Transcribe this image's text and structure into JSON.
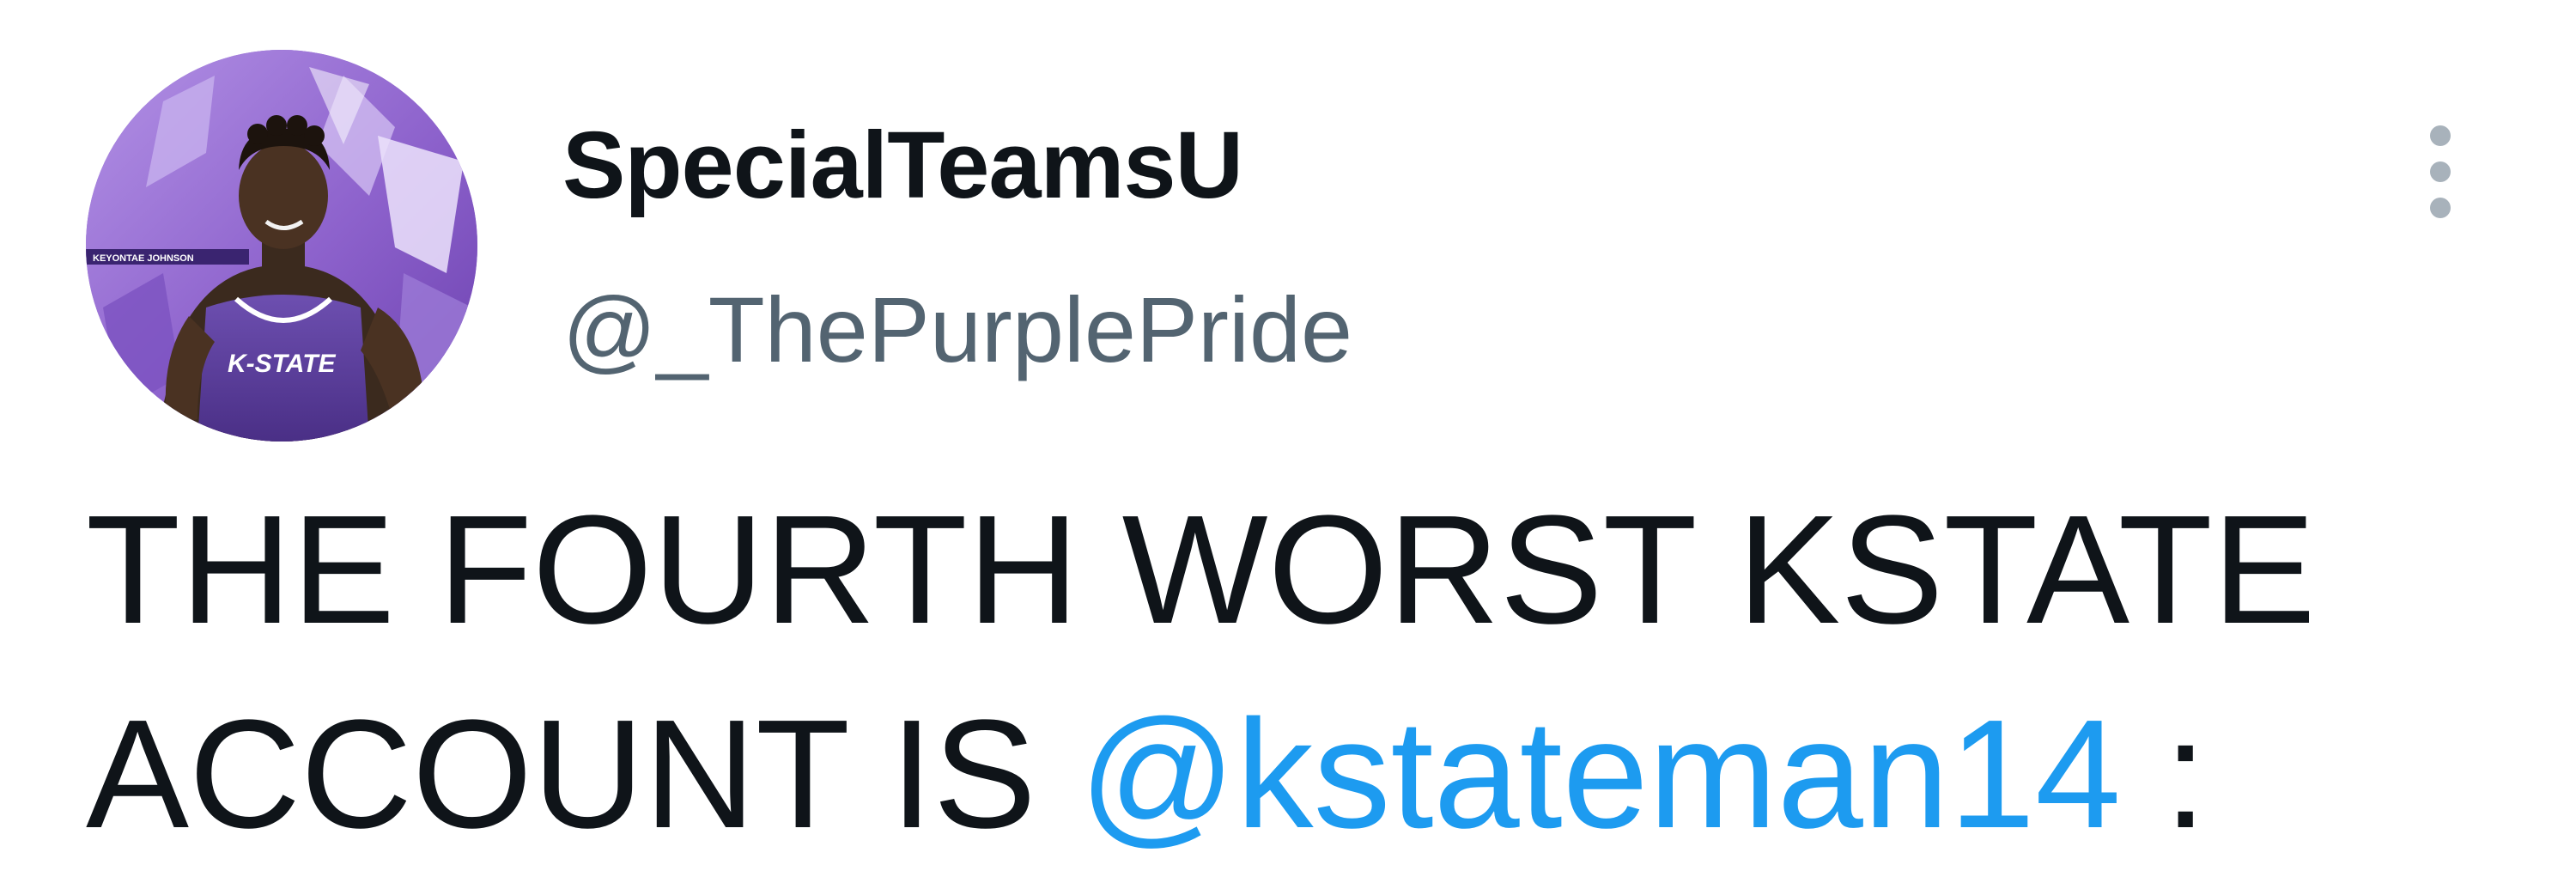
{
  "tweet": {
    "author": {
      "display_name": "SpecialTeamsU",
      "handle": "@_ThePurplePride",
      "avatar_icon": "profile-photo-avatar",
      "avatar_text": {
        "banner": "KEYONTAE JOHNSON",
        "jersey": "K-STATE"
      }
    },
    "text": {
      "line1": "THE FOURTH WORST KSTATE",
      "line2_prefix": "ACCOUNT IS ",
      "mention": "@kstateman14",
      "line2_suffix": " :"
    },
    "more_icon": "more-vertical-icon"
  },
  "colors": {
    "text_primary": "#0f1419",
    "text_secondary": "#536471",
    "link": "#1d9bf0",
    "more_icon": "#a8b2bb",
    "avatar_purple": "#8b63c9"
  }
}
